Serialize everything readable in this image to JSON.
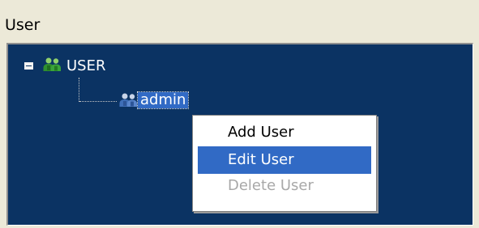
{
  "panel": {
    "title": "User"
  },
  "tree": {
    "root": {
      "label": "USER",
      "icon": "users-group-icon",
      "expanded": true
    },
    "child": {
      "label": "admin",
      "icon": "users-group-icon",
      "selected": true
    }
  },
  "context_menu": {
    "items": [
      {
        "label": "Add User",
        "state": "normal"
      },
      {
        "label": "Edit User",
        "state": "highlighted"
      },
      {
        "label": "Delete User",
        "state": "disabled"
      }
    ]
  },
  "colors": {
    "tree_background": "#0b3363",
    "selection": "#316ac5",
    "window_background": "#ece9d8",
    "disabled_text": "#a8a8a8"
  }
}
